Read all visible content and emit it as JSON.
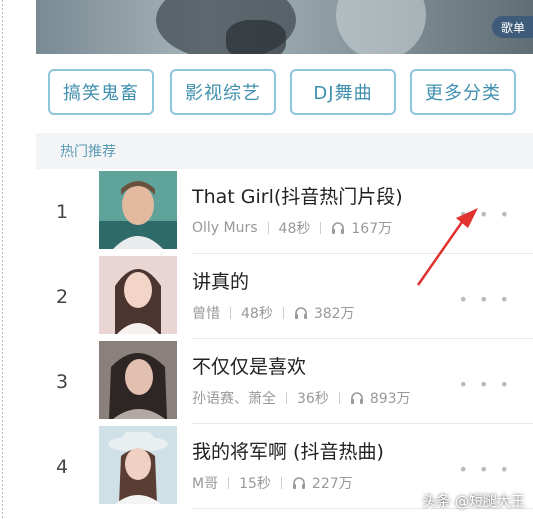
{
  "banner": {
    "badge": "歌单"
  },
  "categories": [
    "搞笑鬼畜",
    "影视综艺",
    "DJ舞曲",
    "更多分类"
  ],
  "section_title": "热门推荐",
  "songs": [
    {
      "rank": "1",
      "title": "That Girl(抖音热门片段)",
      "artist": "Olly Murs",
      "duration": "48秒",
      "plays": "167万"
    },
    {
      "rank": "2",
      "title": "讲真的",
      "artist": "曾惜",
      "duration": "48秒",
      "plays": "382万"
    },
    {
      "rank": "3",
      "title": "不仅仅是喜欢",
      "artist": "孙语赛、萧全",
      "duration": "36秒",
      "plays": "893万"
    },
    {
      "rank": "4",
      "title": "我的将军啊 (抖音热曲)",
      "artist": "M哥",
      "duration": "15秒",
      "plays": "227万"
    }
  ],
  "more_label": "• • •",
  "watermark": "头条 @短腿大王",
  "colors": {
    "accent": "#3f8fae",
    "button_border": "#8ec6dc",
    "annotation_arrow": "#e0322f"
  }
}
